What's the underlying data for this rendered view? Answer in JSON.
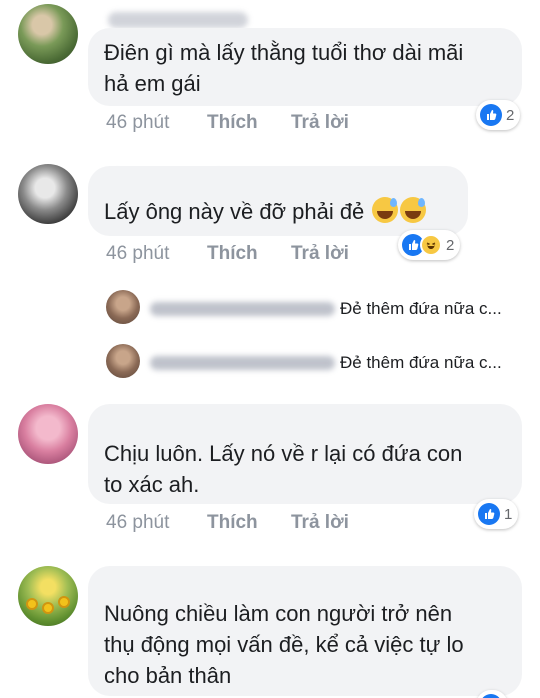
{
  "colors": {
    "bubble": "#f2f3f5",
    "meta": "#8d949e",
    "like": "#1877f2",
    "haha": "#f7c843"
  },
  "comments": [
    {
      "text": "Điên gì mà lấy thằng tuổi thơ dài mãi\nhả em gái",
      "time": "46 phút",
      "like": "Thích",
      "reply": "Trả lời",
      "reactions": "2"
    },
    {
      "text": "Lấy ông này về đỡ phải đẻ",
      "time": "46 phút",
      "like": "Thích",
      "reply": "Trả lời",
      "reactions": "2",
      "replies": [
        {
          "text": "Đẻ thêm đứa nữa c..."
        },
        {
          "text": "Đẻ thêm đứa nữa c..."
        }
      ]
    },
    {
      "text": "Chịu luôn. Lấy nó về r lại có đứa con\nto xác ah.",
      "time": "46 phút",
      "like": "Thích",
      "reply": "Trả lời",
      "reactions": "1"
    },
    {
      "text": "Nuông chiều làm con người trở nên\nthụ động mọi vấn đề, kể cả việc tự lo\ncho bản thân"
    }
  ],
  "icons": {
    "like": "thumbs-up-icon",
    "haha": "laugh-icon",
    "emoji": "sweat-smile-emoji"
  }
}
